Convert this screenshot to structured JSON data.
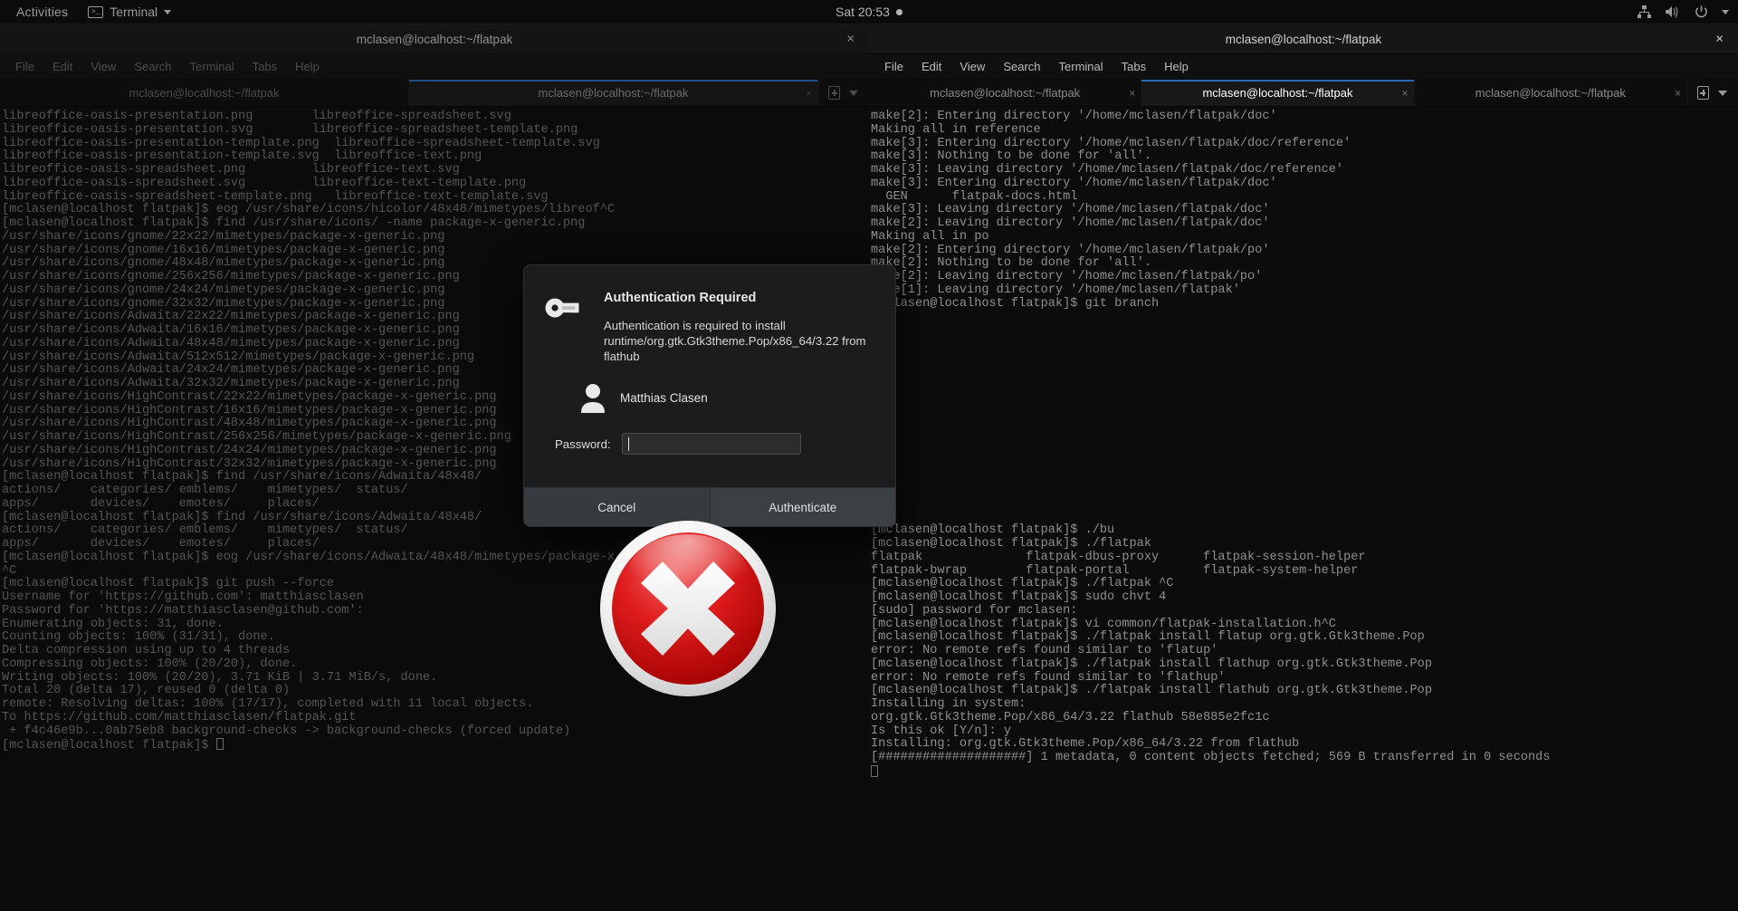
{
  "topbar": {
    "activities": "Activities",
    "app_name": "Terminal",
    "app_icon": "terminal-icon",
    "clock": "Sat 20:53",
    "icons": [
      "network-icon",
      "volume-muted-icon",
      "power-icon",
      "chevron-down-icon"
    ]
  },
  "windows": {
    "left": {
      "title": "mclasen@localhost:~/flatpak",
      "close_label": "×",
      "menu": [
        "File",
        "Edit",
        "View",
        "Search",
        "Terminal",
        "Tabs",
        "Help"
      ],
      "tabs": [
        {
          "label": "mclasen@localhost:~/flatpak",
          "active": false
        },
        {
          "label": "mclasen@localhost:~/flatpak",
          "active": true
        }
      ],
      "lines": [
        "libreoffice-oasis-presentation.png        libreoffice-spreadsheet.svg",
        "libreoffice-oasis-presentation.svg        libreoffice-spreadsheet-template.png",
        "libreoffice-oasis-presentation-template.png  libreoffice-spreadsheet-template.svg",
        "libreoffice-oasis-presentation-template.svg  libreoffice-text.png",
        "libreoffice-oasis-spreadsheet.png         libreoffice-text.svg",
        "libreoffice-oasis-spreadsheet.svg         libreoffice-text-template.png",
        "libreoffice-oasis-spreadsheet-template.png   libreoffice-text-template.svg",
        "[mclasen@localhost flatpak]$ eog /usr/share/icons/hicolor/48x48/mimetypes/libreof^C",
        "[mclasen@localhost flatpak]$ find /usr/share/icons/ -name package-x-generic.png",
        "/usr/share/icons/gnome/22x22/mimetypes/package-x-generic.png",
        "/usr/share/icons/gnome/16x16/mimetypes/package-x-generic.png",
        "/usr/share/icons/gnome/48x48/mimetypes/package-x-generic.png",
        "/usr/share/icons/gnome/256x256/mimetypes/package-x-generic.png",
        "/usr/share/icons/gnome/24x24/mimetypes/package-x-generic.png",
        "/usr/share/icons/gnome/32x32/mimetypes/package-x-generic.png",
        "/usr/share/icons/Adwaita/22x22/mimetypes/package-x-generic.png",
        "/usr/share/icons/Adwaita/16x16/mimetypes/package-x-generic.png",
        "/usr/share/icons/Adwaita/48x48/mimetypes/package-x-generic.png",
        "/usr/share/icons/Adwaita/512x512/mimetypes/package-x-generic.png",
        "/usr/share/icons/Adwaita/24x24/mimetypes/package-x-generic.png",
        "/usr/share/icons/Adwaita/32x32/mimetypes/package-x-generic.png",
        "/usr/share/icons/HighContrast/22x22/mimetypes/package-x-generic.png",
        "/usr/share/icons/HighContrast/16x16/mimetypes/package-x-generic.png",
        "/usr/share/icons/HighContrast/48x48/mimetypes/package-x-generic.png",
        "/usr/share/icons/HighContrast/256x256/mimetypes/package-x-generic.png",
        "/usr/share/icons/HighContrast/24x24/mimetypes/package-x-generic.png",
        "/usr/share/icons/HighContrast/32x32/mimetypes/package-x-generic.png",
        "[mclasen@localhost flatpak]$ find /usr/share/icons/Adwaita/48x48/",
        "actions/    categories/ emblems/    mimetypes/  status/",
        "apps/       devices/    emotes/     places/",
        "[mclasen@localhost flatpak]$ find /usr/share/icons/Adwaita/48x48/",
        "actions/    categories/ emblems/    mimetypes/  status/",
        "apps/       devices/    emotes/     places/",
        "[mclasen@localhost flatpak]$ eog /usr/share/icons/Adwaita/48x48/mimetypes/package-x-generic",
        "^C",
        "[mclasen@localhost flatpak]$ git push --force",
        "Username for 'https://github.com': matthiasclasen",
        "Password for 'https://matthiasclasen@github.com':",
        "Enumerating objects: 31, done.",
        "Counting objects: 100% (31/31), done.",
        "Delta compression using up to 4 threads",
        "Compressing objects: 100% (20/20), done.",
        "Writing objects: 100% (20/20), 3.71 KiB | 3.71 MiB/s, done.",
        "Total 20 (delta 17), reused 0 (delta 0)",
        "remote: Resolving deltas: 100% (17/17), completed with 11 local objects.",
        "To https://github.com/matthiasclasen/flatpak.git",
        " + f4c46e9b...0ab75eb8 background-checks -> background-checks (forced update)",
        "[mclasen@localhost flatpak]$ "
      ]
    },
    "right": {
      "title": "mclasen@localhost:~/flatpak",
      "close_label": "×",
      "menu": [
        "File",
        "Edit",
        "View",
        "Search",
        "Terminal",
        "Tabs",
        "Help"
      ],
      "tabs": [
        {
          "label": "mclasen@localhost:~/flatpak",
          "active": false
        },
        {
          "label": "mclasen@localhost:~/flatpak",
          "active": true
        },
        {
          "label": "mclasen@localhost:~/flatpak",
          "active": false
        }
      ],
      "lines": [
        "make[2]: Entering directory '/home/mclasen/flatpak/doc'",
        "Making all in reference",
        "make[3]: Entering directory '/home/mclasen/flatpak/doc/reference'",
        "make[3]: Nothing to be done for 'all'.",
        "make[3]: Leaving directory '/home/mclasen/flatpak/doc/reference'",
        "make[3]: Entering directory '/home/mclasen/flatpak/doc'",
        "  GEN      flatpak-docs.html",
        "make[3]: Leaving directory '/home/mclasen/flatpak/doc'",
        "make[2]: Leaving directory '/home/mclasen/flatpak/doc'",
        "Making all in po",
        "make[2]: Entering directory '/home/mclasen/flatpak/po'",
        "make[2]: Nothing to be done for 'all'.",
        "make[2]: Leaving directory '/home/mclasen/flatpak/po'",
        "make[1]: Leaving directory '/home/mclasen/flatpak'",
        "[mclasen@localhost flatpak]$ git branch",
        "",
        "",
        "",
        "",
        "",
        "",
        "",
        "",
        "",
        "",
        "",
        "",
        "",
        "",
        "",
        "",
        "[mclasen@localhost flatpak]$ ./bu",
        "[mclasen@localhost flatpak]$ ./flatpak",
        "flatpak              flatpak-dbus-proxy      flatpak-session-helper",
        "flatpak-bwrap        flatpak-portal          flatpak-system-helper",
        "[mclasen@localhost flatpak]$ ./flatpak ^C",
        "[mclasen@localhost flatpak]$ sudo chvt 4",
        "[sudo] password for mclasen:",
        "[mclasen@localhost flatpak]$ vi common/flatpak-installation.h^C",
        "[mclasen@localhost flatpak]$ ./flatpak install flatup org.gtk.Gtk3theme.Pop",
        "error: No remote refs found similar to 'flatup'",
        "[mclasen@localhost flatpak]$ ./flatpak install flathup org.gtk.Gtk3theme.Pop",
        "error: No remote refs found similar to 'flathup'",
        "[mclasen@localhost flatpak]$ ./flatpak install flathub org.gtk.Gtk3theme.Pop",
        "Installing in system:",
        "org.gtk.Gtk3theme.Pop/x86_64/3.22 flathub 58e885e2fc1c",
        "Is this ok [Y/n]: y",
        "Installing: org.gtk.Gtk3theme.Pop/x86_64/3.22 from flathub",
        "[####################] 1 metadata, 0 content objects fetched; 569 B transferred in 0 seconds",
        ""
      ]
    }
  },
  "auth_dialog": {
    "icon": "key-icon",
    "title": "Authentication Required",
    "message": "Authentication is required to install runtime/org.gtk.Gtk3theme.Pop/x86_64/3.22 from flathub",
    "user_name": "Matthias Clasen",
    "user_avatar": "user-avatar-icon",
    "password_label": "Password:",
    "password_value": "",
    "password_placeholder": "",
    "cancel_label": "Cancel",
    "authenticate_label": "Authenticate"
  },
  "overlay": {
    "cursor_icon": "red-x-error-icon",
    "accent_red": "#cc0000"
  }
}
